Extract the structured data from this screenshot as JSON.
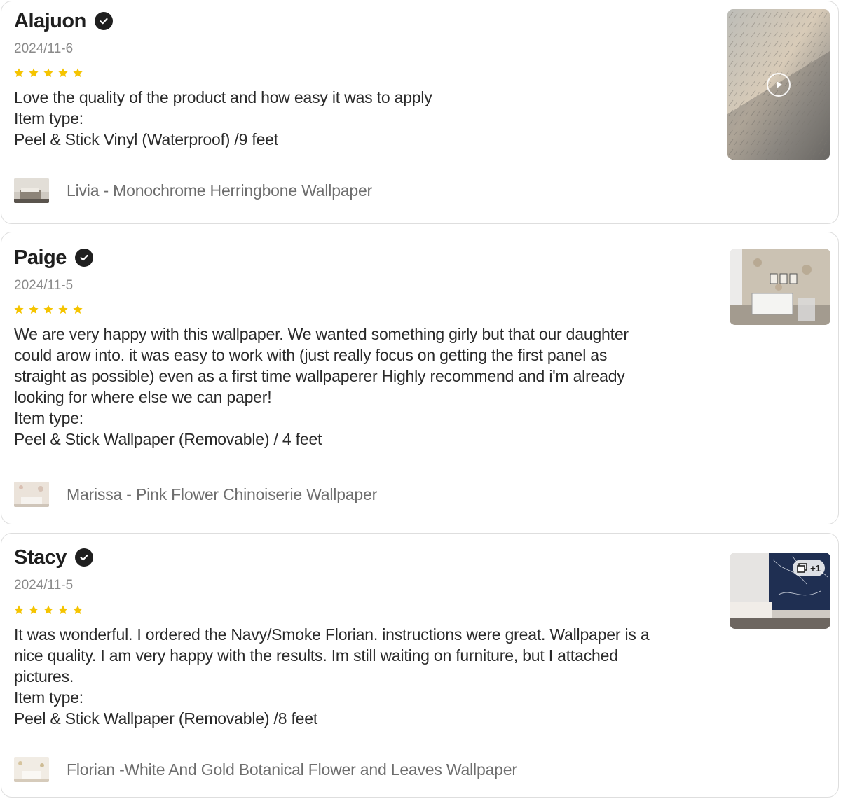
{
  "reviews": [
    {
      "name": "Alajuon",
      "date": "2024/11-6",
      "rating": 5,
      "lines": [
        "Love the quality of the product and how easy it was to apply",
        "Item type:",
        "Peel & Stick Vinyl (Waterproof) /9 feet"
      ],
      "product": "Livia - Monochrome Herringbone Wallpaper",
      "media_type": "video"
    },
    {
      "name": "Paige",
      "date": "2024/11-5",
      "rating": 5,
      "lines": [
        "We are very happy with this wallpaper. We wanted something girly but that our daughter",
        "could arow into. it was easy to work with (just really focus on getting the first panel as",
        "straight as possible) even as a first time wallpaperer Highly recommend and i'm already",
        "looking for where else we can paper!",
        "Item type:",
        "Peel & Stick Wallpaper (Removable) / 4 feet"
      ],
      "product": "Marissa - Pink Flower Chinoiserie Wallpaper",
      "media_type": "image"
    },
    {
      "name": "Stacy",
      "date": "2024/11-5",
      "rating": 5,
      "lines": [
        "It was wonderful. I ordered the Navy/Smoke Florian. instructions were great. Wallpaper is a",
        "nice quality. I am very happy with the results. Im still waiting on furniture, but I attached",
        "pictures.",
        "Item type:",
        "Peel & Stick Wallpaper (Removable) /8 feet"
      ],
      "product": "Florian -White And Gold Botanical Flower and Leaves Wallpaper",
      "media_type": "gallery",
      "extra_images_badge": "+1"
    }
  ],
  "icons": {
    "verified": "check-circle-icon",
    "star": "star-icon",
    "play": "play-icon",
    "gallery": "image-stack-icon"
  },
  "colors": {
    "star": "#f5c400",
    "verified": "#1f1f1f",
    "text": "#2a2a2a",
    "muted": "#8a8a8a"
  }
}
